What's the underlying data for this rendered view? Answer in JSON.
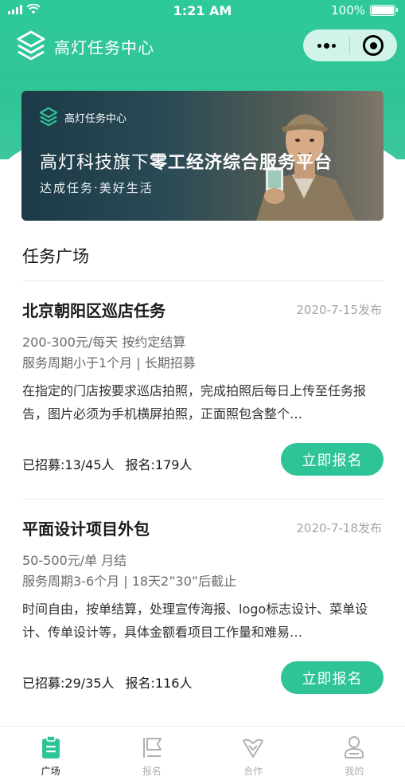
{
  "status_bar": {
    "time": "1:21 AM",
    "battery": "100%",
    "battery_level": 1.0
  },
  "header": {
    "app_title": "高灯任务中心"
  },
  "banner": {
    "logo_text": "高灯任务中心",
    "headline_normal": "高灯科技旗下",
    "headline_bold": "零工经济综合服务平台",
    "subtitle": "达成任务·美好生活"
  },
  "section": {
    "title": "任务广场"
  },
  "tasks": [
    {
      "title": "北京朝阳区巡店任务",
      "date": "2020-7-15发布",
      "pay": "200-300元/每天  按约定结算",
      "period": "服务周期小于1个月 | 长期招募",
      "description": "在指定的门店按要求巡店拍照，完成拍照后每日上传至任务报告，图片必须为手机横屏拍照，正面照包含整个…",
      "recruited": "已招募:13/45人",
      "signed": "报名:179人",
      "button_label": "立即报名"
    },
    {
      "title": "平面设计项目外包",
      "date": "2020-7-18发布",
      "pay": "50-500元/单  月结",
      "period": "服务周期3-6个月 | 18天2”30”后截止",
      "description": "时间自由，按单结算，处理宣传海报、logo标志设计、菜单设计、传单设计等，具体金额看项目工作量和难易…",
      "recruited": "已招募:29/35人",
      "signed": "报名:116人",
      "button_label": "立即报名"
    }
  ],
  "tab_bar": {
    "items": [
      {
        "label": "广场",
        "icon": "clipboard-icon",
        "active": true
      },
      {
        "label": "报名",
        "icon": "flag-icon",
        "active": false
      },
      {
        "label": "合作",
        "icon": "handshake-icon",
        "active": false
      },
      {
        "label": "我的",
        "icon": "user-icon",
        "active": false
      }
    ]
  },
  "colors": {
    "brand": "#2fc398",
    "header_gradient": "#2ec99a",
    "muted_text": "#a6a6a6",
    "inactive_tab": "#b0b0b0"
  }
}
